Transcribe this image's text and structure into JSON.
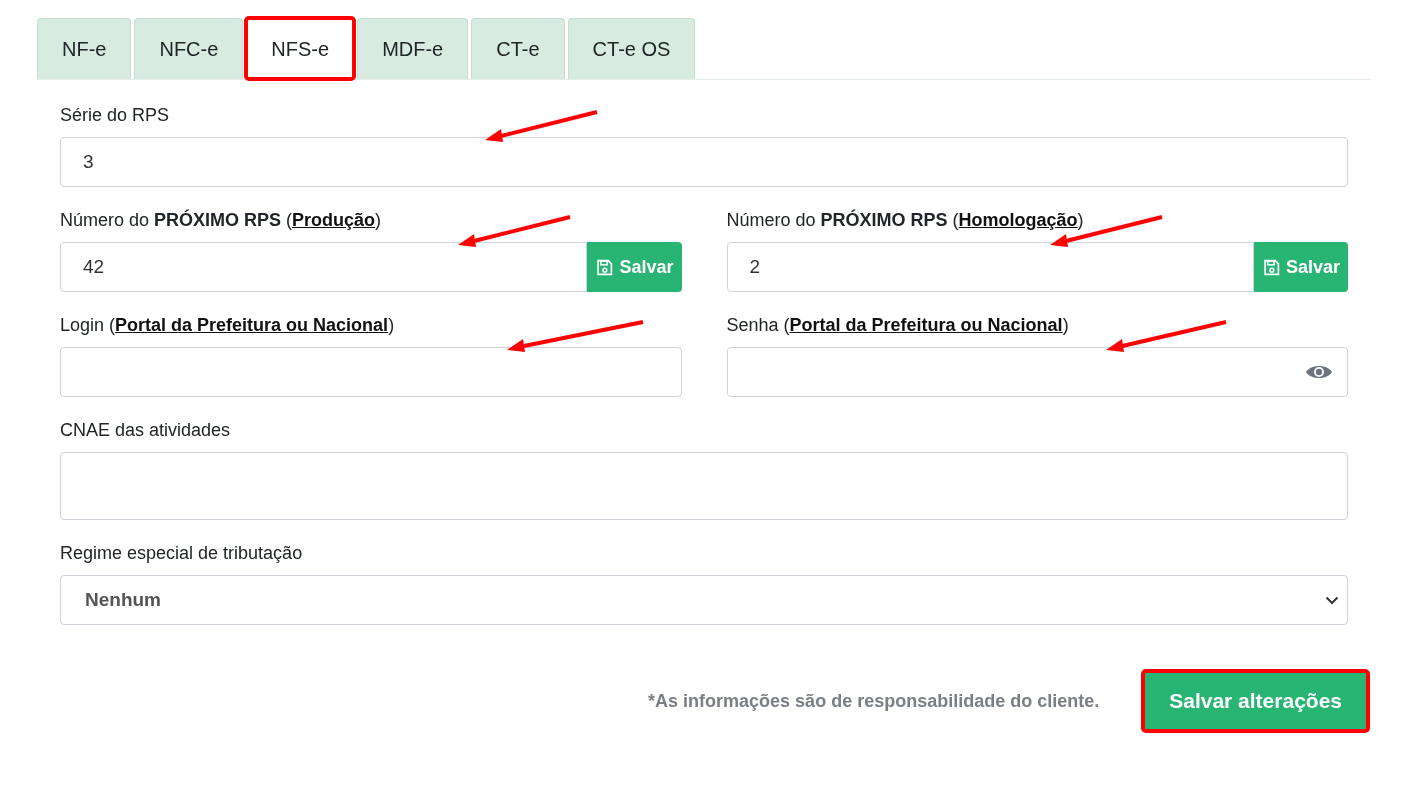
{
  "tabs": [
    {
      "label": "NF-e",
      "selected": false,
      "highlighted": false
    },
    {
      "label": "NFC-e",
      "selected": false,
      "highlighted": false
    },
    {
      "label": "NFS-e",
      "selected": true,
      "highlighted": true
    },
    {
      "label": "MDF-e",
      "selected": false,
      "highlighted": false
    },
    {
      "label": "CT-e",
      "selected": false,
      "highlighted": false
    },
    {
      "label": "CT-e OS",
      "selected": false,
      "highlighted": false
    }
  ],
  "serie": {
    "label": {
      "text": "Série do RPS"
    },
    "value": "3",
    "arrow": true
  },
  "numbers": [
    {
      "label": {
        "text": "Número do **PRÓXIMO RPS** (",
        "link": "Produção",
        "suffix": ")"
      },
      "value": "42",
      "button": "Salvar",
      "arrow": true
    },
    {
      "label": {
        "text": "Número do **PRÓXIMO RPS** (",
        "link": "Homologação",
        "suffix": ")"
      },
      "value": "2",
      "button": "Salvar",
      "arrow": true
    }
  ],
  "login": {
    "label": {
      "text": "Login (",
      "link": "Portal da Prefeitura ou Nacional",
      "suffix": ")"
    },
    "arrow": true
  },
  "senha": {
    "label": {
      "text": "Senha (",
      "link": "Portal da Prefeitura ou Nacional",
      "suffix": ")"
    },
    "arrow": true
  },
  "cnae": {
    "label": {
      "text": "CNAE das atividades"
    }
  },
  "regime": {
    "label": {
      "text": "Regime especial de tributação"
    },
    "value": "Nenhum"
  },
  "footer": {
    "note": "*As informações são de responsabilidade do cliente.",
    "button": "Salvar alterações",
    "highlighted": true
  }
}
